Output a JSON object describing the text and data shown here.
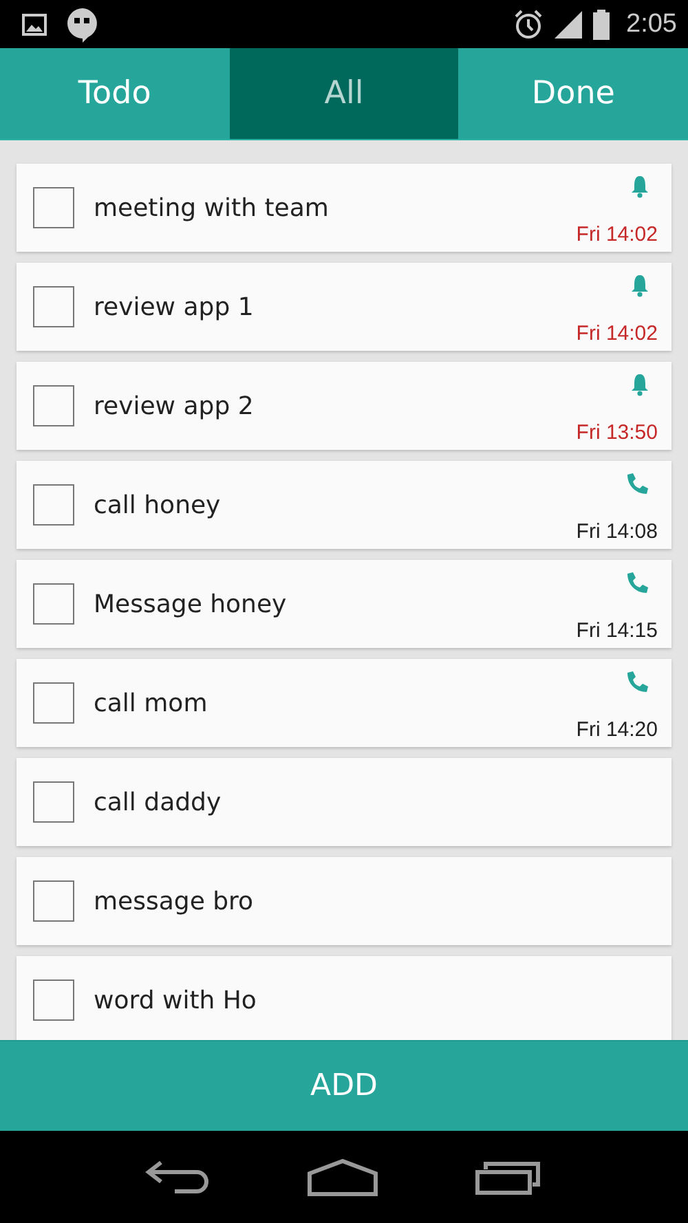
{
  "status_bar": {
    "time": "2:05"
  },
  "tabs": [
    {
      "label": "Todo",
      "selected": false
    },
    {
      "label": "All",
      "selected": true
    },
    {
      "label": "Done",
      "selected": false
    }
  ],
  "tasks": [
    {
      "kind": "alarm",
      "title": "meeting with team",
      "checked": false,
      "time": "Fri 14:02",
      "overdue": true
    },
    {
      "kind": "alarm",
      "title": "review app 1",
      "checked": false,
      "time": "Fri 14:02",
      "overdue": true
    },
    {
      "kind": "alarm",
      "title": "review app 2",
      "checked": false,
      "time": "Fri 13:50",
      "overdue": true
    },
    {
      "kind": "call",
      "title": "call honey",
      "checked": false,
      "time": "Fri 14:08",
      "overdue": false
    },
    {
      "kind": "call",
      "title": "Message honey",
      "checked": false,
      "time": "Fri 14:15",
      "overdue": false
    },
    {
      "kind": "call",
      "title": "call mom",
      "checked": false,
      "time": "Fri 14:20",
      "overdue": false
    },
    {
      "kind": "plain",
      "title": "call daddy",
      "checked": false
    },
    {
      "kind": "plain",
      "title": "message bro",
      "checked": false
    },
    {
      "kind": "plain",
      "title": "word with Ho",
      "checked": false
    }
  ],
  "add_button": "ADD"
}
